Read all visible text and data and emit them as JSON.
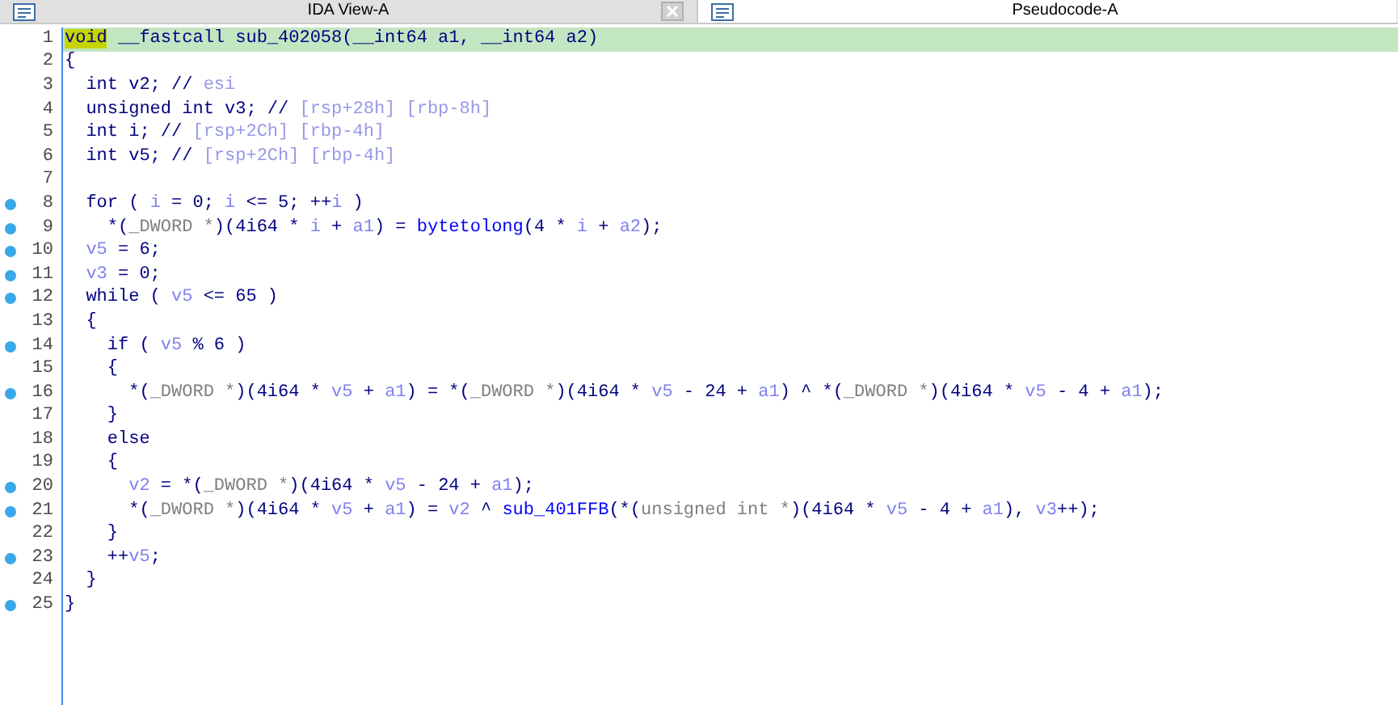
{
  "tabs": [
    {
      "label": "IDA View-A",
      "selected": false,
      "closable": true
    },
    {
      "label": "Pseudocode-A",
      "selected": true,
      "closable": false
    }
  ],
  "lines": [
    {
      "number": "1",
      "breakpoint": false,
      "selected": true,
      "code": [
        {
          "kind": "cursor",
          "text": "void"
        },
        {
          "kind": "plain",
          "text": " __fastcall sub_402058(__int64 a1, __int64 a2)"
        }
      ]
    },
    {
      "number": "2",
      "breakpoint": false,
      "selected": false,
      "code": [
        {
          "kind": "plain",
          "text": "{"
        }
      ]
    },
    {
      "number": "3",
      "breakpoint": false,
      "selected": false,
      "code": [
        {
          "kind": "plain",
          "text": "  int v2; // "
        },
        {
          "kind": "comment",
          "text": "esi"
        }
      ]
    },
    {
      "number": "4",
      "breakpoint": false,
      "selected": false,
      "code": [
        {
          "kind": "plain",
          "text": "  unsigned int v3; // "
        },
        {
          "kind": "comment",
          "text": "[rsp+28h] [rbp-8h]"
        }
      ]
    },
    {
      "number": "5",
      "breakpoint": false,
      "selected": false,
      "code": [
        {
          "kind": "plain",
          "text": "  int i; // "
        },
        {
          "kind": "comment",
          "text": "[rsp+2Ch] [rbp-4h]"
        }
      ]
    },
    {
      "number": "6",
      "breakpoint": false,
      "selected": false,
      "code": [
        {
          "kind": "plain",
          "text": "  int v5; // "
        },
        {
          "kind": "comment",
          "text": "[rsp+2Ch] [rbp-4h]"
        }
      ]
    },
    {
      "number": "7",
      "breakpoint": false,
      "selected": false
    },
    {
      "number": "8",
      "breakpoint": true,
      "selected": false,
      "code": [
        {
          "kind": "plain",
          "text": "  for ( "
        },
        {
          "kind": "var",
          "text": "i"
        },
        {
          "kind": "plain",
          "text": " = 0; "
        },
        {
          "kind": "var",
          "text": "i"
        },
        {
          "kind": "plain",
          "text": " <= 5; ++"
        },
        {
          "kind": "var",
          "text": "i"
        },
        {
          "kind": "plain",
          "text": " )"
        }
      ]
    },
    {
      "number": "9",
      "breakpoint": true,
      "selected": false,
      "code": [
        {
          "kind": "plain",
          "text": "    *("
        },
        {
          "kind": "cast",
          "text": "_DWORD *"
        },
        {
          "kind": "plain",
          "text": ")(4i64 * "
        },
        {
          "kind": "var",
          "text": "i"
        },
        {
          "kind": "plain",
          "text": " + "
        },
        {
          "kind": "var",
          "text": "a1"
        },
        {
          "kind": "plain",
          "text": ") = "
        },
        {
          "kind": "func",
          "text": "bytetolong"
        },
        {
          "kind": "plain",
          "text": "(4 * "
        },
        {
          "kind": "var",
          "text": "i"
        },
        {
          "kind": "plain",
          "text": " + "
        },
        {
          "kind": "var",
          "text": "a2"
        },
        {
          "kind": "plain",
          "text": ");"
        }
      ]
    },
    {
      "number": "10",
      "breakpoint": true,
      "selected": false,
      "code": [
        {
          "kind": "var",
          "text": "  v5"
        },
        {
          "kind": "plain",
          "text": " = 6;"
        }
      ]
    },
    {
      "number": "11",
      "breakpoint": true,
      "selected": false,
      "code": [
        {
          "kind": "var",
          "text": "  v3"
        },
        {
          "kind": "plain",
          "text": " = 0;"
        }
      ]
    },
    {
      "number": "12",
      "breakpoint": true,
      "selected": false,
      "code": [
        {
          "kind": "plain",
          "text": "  while ( "
        },
        {
          "kind": "var",
          "text": "v5"
        },
        {
          "kind": "plain",
          "text": " <= 65 )"
        }
      ]
    },
    {
      "number": "13",
      "breakpoint": false,
      "selected": false,
      "code": [
        {
          "kind": "plain",
          "text": "  {"
        }
      ]
    },
    {
      "number": "14",
      "breakpoint": true,
      "selected": false,
      "code": [
        {
          "kind": "plain",
          "text": "    if ( "
        },
        {
          "kind": "var",
          "text": "v5"
        },
        {
          "kind": "plain",
          "text": " % 6 )"
        }
      ]
    },
    {
      "number": "15",
      "breakpoint": false,
      "selected": false,
      "code": [
        {
          "kind": "plain",
          "text": "    {"
        }
      ]
    },
    {
      "number": "16",
      "breakpoint": true,
      "selected": false,
      "code": [
        {
          "kind": "plain",
          "text": "      *("
        },
        {
          "kind": "cast",
          "text": "_DWORD *"
        },
        {
          "kind": "plain",
          "text": ")(4i64 * "
        },
        {
          "kind": "var",
          "text": "v5"
        },
        {
          "kind": "plain",
          "text": " + "
        },
        {
          "kind": "var",
          "text": "a1"
        },
        {
          "kind": "plain",
          "text": ") = *("
        },
        {
          "kind": "cast",
          "text": "_DWORD *"
        },
        {
          "kind": "plain",
          "text": ")(4i64 * "
        },
        {
          "kind": "var",
          "text": "v5"
        },
        {
          "kind": "plain",
          "text": " - 24 + "
        },
        {
          "kind": "var",
          "text": "a1"
        },
        {
          "kind": "plain",
          "text": ") ^ *("
        },
        {
          "kind": "cast",
          "text": "_DWORD *"
        },
        {
          "kind": "plain",
          "text": ")(4i64 * "
        },
        {
          "kind": "var",
          "text": "v5"
        },
        {
          "kind": "plain",
          "text": " - 4 + "
        },
        {
          "kind": "var",
          "text": "a1"
        },
        {
          "kind": "plain",
          "text": ");"
        }
      ]
    },
    {
      "number": "17",
      "breakpoint": false,
      "selected": false,
      "code": [
        {
          "kind": "plain",
          "text": "    }"
        }
      ]
    },
    {
      "number": "18",
      "breakpoint": false,
      "selected": false,
      "code": [
        {
          "kind": "plain",
          "text": "    else"
        }
      ]
    },
    {
      "number": "19",
      "breakpoint": false,
      "selected": false,
      "code": [
        {
          "kind": "plain",
          "text": "    {"
        }
      ]
    },
    {
      "number": "20",
      "breakpoint": true,
      "selected": false,
      "code": [
        {
          "kind": "var",
          "text": "      v2"
        },
        {
          "kind": "plain",
          "text": " = *("
        },
        {
          "kind": "cast",
          "text": "_DWORD *"
        },
        {
          "kind": "plain",
          "text": ")(4i64 * "
        },
        {
          "kind": "var",
          "text": "v5"
        },
        {
          "kind": "plain",
          "text": " - 24 + "
        },
        {
          "kind": "var",
          "text": "a1"
        },
        {
          "kind": "plain",
          "text": ");"
        }
      ]
    },
    {
      "number": "21",
      "breakpoint": true,
      "selected": false,
      "code": [
        {
          "kind": "plain",
          "text": "      *("
        },
        {
          "kind": "cast",
          "text": "_DWORD *"
        },
        {
          "kind": "plain",
          "text": ")(4i64 * "
        },
        {
          "kind": "var",
          "text": "v5"
        },
        {
          "kind": "plain",
          "text": " + "
        },
        {
          "kind": "var",
          "text": "a1"
        },
        {
          "kind": "plain",
          "text": ") = "
        },
        {
          "kind": "var",
          "text": "v2"
        },
        {
          "kind": "plain",
          "text": " ^ "
        },
        {
          "kind": "func",
          "text": "sub_401FFB"
        },
        {
          "kind": "plain",
          "text": "(*("
        },
        {
          "kind": "cast",
          "text": "unsigned int *"
        },
        {
          "kind": "plain",
          "text": ")(4i64 * "
        },
        {
          "kind": "var",
          "text": "v5"
        },
        {
          "kind": "plain",
          "text": " - 4 + "
        },
        {
          "kind": "var",
          "text": "a1"
        },
        {
          "kind": "plain",
          "text": "), "
        },
        {
          "kind": "var",
          "text": "v3"
        },
        {
          "kind": "plain",
          "text": "++);"
        }
      ]
    },
    {
      "number": "22",
      "breakpoint": false,
      "selected": false,
      "code": [
        {
          "kind": "plain",
          "text": "    }"
        }
      ]
    },
    {
      "number": "23",
      "breakpoint": true,
      "selected": false,
      "code": [
        {
          "kind": "plain",
          "text": "    ++"
        },
        {
          "kind": "var",
          "text": "v5"
        },
        {
          "kind": "plain",
          "text": ";"
        }
      ]
    },
    {
      "number": "24",
      "breakpoint": false,
      "selected": false,
      "code": [
        {
          "kind": "plain",
          "text": "  }"
        }
      ]
    },
    {
      "number": "25",
      "breakpoint": true,
      "selected": false,
      "code": [
        {
          "kind": "plain",
          "text": "}"
        }
      ]
    }
  ]
}
